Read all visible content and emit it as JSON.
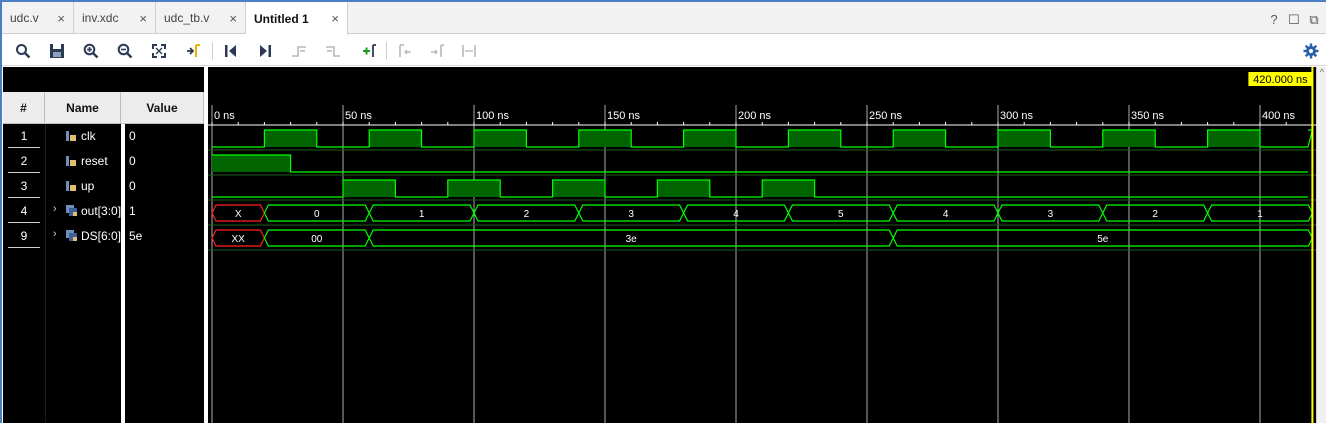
{
  "tabs": [
    {
      "label": "udc.v",
      "active": false
    },
    {
      "label": "inv.xdc",
      "active": false
    },
    {
      "label": "udc_tb.v",
      "active": false
    },
    {
      "label": "Untitled 1",
      "active": true
    }
  ],
  "tab_close_glyph": "×",
  "window_controls": {
    "help": "?",
    "restore": "☐",
    "detach": "⧉"
  },
  "toolbar": {
    "buttons": [
      {
        "name": "zoom-search-icon"
      },
      {
        "name": "save-icon"
      },
      {
        "name": "zoom-in-icon"
      },
      {
        "name": "zoom-out-icon"
      },
      {
        "name": "zoom-fit-icon"
      },
      {
        "name": "go-to-cursor-icon"
      },
      {
        "name": "go-to-time-zero-icon"
      },
      {
        "name": "go-to-last-time-icon"
      },
      {
        "name": "previous-transition-icon"
      },
      {
        "name": "next-transition-icon"
      },
      {
        "name": "add-marker-icon"
      },
      {
        "name": "previous-marker-icon"
      },
      {
        "name": "next-marker-icon"
      },
      {
        "name": "swap-cursors-icon"
      }
    ],
    "settings": "gear-icon"
  },
  "columns": {
    "num": "#",
    "name": "Name",
    "value": "Value"
  },
  "signals": [
    {
      "num": "1",
      "name": "clk",
      "value": "0",
      "kind": "bit",
      "expandable": false
    },
    {
      "num": "2",
      "name": "reset",
      "value": "0",
      "kind": "bit",
      "expandable": false
    },
    {
      "num": "3",
      "name": "up",
      "value": "0",
      "kind": "bit",
      "expandable": false
    },
    {
      "num": "4",
      "name": "out[3:0]",
      "value": "1",
      "kind": "bus",
      "expandable": true
    },
    {
      "num": "9",
      "name": "DS[6:0]",
      "value": "5e",
      "kind": "bus",
      "expandable": true
    }
  ],
  "expander_glyph": "›",
  "cursor": {
    "label": "420.000 ns",
    "time_ns": 420
  },
  "timeline": {
    "start_ns": 0,
    "end_ns": 418.3,
    "ticks": [
      {
        "t": 0,
        "label": "0 ns"
      },
      {
        "t": 50,
        "label": "50 ns"
      },
      {
        "t": 100,
        "label": "100 ns"
      },
      {
        "t": 150,
        "label": "150 ns"
      },
      {
        "t": 200,
        "label": "200 ns"
      },
      {
        "t": 250,
        "label": "250 ns"
      },
      {
        "t": 300,
        "label": "300 ns"
      },
      {
        "t": 350,
        "label": "350 ns"
      },
      {
        "t": 400,
        "label": "400 ns"
      }
    ]
  },
  "waves": {
    "clk": [
      [
        0,
        0
      ],
      [
        20,
        1
      ],
      [
        40,
        0
      ],
      [
        60,
        1
      ],
      [
        80,
        0
      ],
      [
        100,
        1
      ],
      [
        120,
        0
      ],
      [
        140,
        1
      ],
      [
        160,
        0
      ],
      [
        180,
        1
      ],
      [
        200,
        0
      ],
      [
        220,
        1
      ],
      [
        240,
        0
      ],
      [
        260,
        1
      ],
      [
        280,
        0
      ],
      [
        300,
        1
      ],
      [
        320,
        0
      ],
      [
        340,
        1
      ],
      [
        360,
        0
      ],
      [
        380,
        1
      ],
      [
        400,
        0
      ],
      [
        420,
        1
      ]
    ],
    "reset": [
      [
        0,
        1
      ],
      [
        30,
        0
      ]
    ],
    "up": [
      [
        0,
        0
      ],
      [
        50,
        1
      ],
      [
        70,
        0
      ],
      [
        90,
        1
      ],
      [
        110,
        0
      ],
      [
        130,
        1
      ],
      [
        150,
        0
      ],
      [
        170,
        1
      ],
      [
        190,
        0
      ],
      [
        210,
        1
      ],
      [
        230,
        0
      ]
    ],
    "out": [
      {
        "start": 0,
        "end": 20,
        "label": "X",
        "unknown": true
      },
      {
        "start": 20,
        "end": 60,
        "label": "0"
      },
      {
        "start": 60,
        "end": 100,
        "label": "1"
      },
      {
        "start": 100,
        "end": 140,
        "label": "2"
      },
      {
        "start": 140,
        "end": 180,
        "label": "3"
      },
      {
        "start": 180,
        "end": 220,
        "label": "4"
      },
      {
        "start": 220,
        "end": 260,
        "label": "5"
      },
      {
        "start": 260,
        "end": 300,
        "label": "4"
      },
      {
        "start": 300,
        "end": 340,
        "label": "3"
      },
      {
        "start": 340,
        "end": 380,
        "label": "2"
      },
      {
        "start": 380,
        "end": 420,
        "label": "1"
      }
    ],
    "DS": [
      {
        "start": 0,
        "end": 20,
        "label": "XX",
        "unknown": true
      },
      {
        "start": 20,
        "end": 60,
        "label": "00"
      },
      {
        "start": 60,
        "end": 260,
        "label": "3e"
      },
      {
        "start": 260,
        "end": 420,
        "label": "5e"
      }
    ]
  },
  "colors": {
    "wave": "#00ff00",
    "wave_fill": "#006400",
    "unknown": "#ff2020",
    "cursor": "#ffff00",
    "grid": "#ffffff",
    "background": "#000000",
    "text": "#ffffff"
  }
}
